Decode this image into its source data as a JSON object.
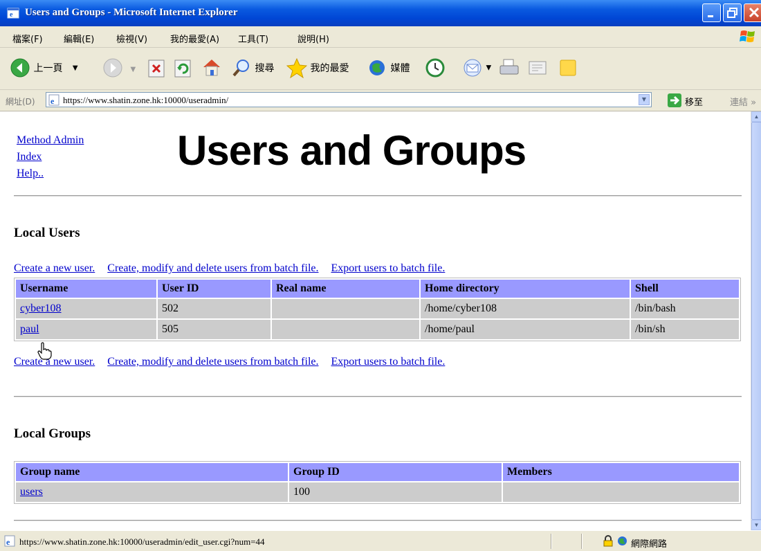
{
  "window": {
    "title": "Users and Groups - Microsoft Internet Explorer"
  },
  "menu": [
    "檔案(F)",
    "編輯(E)",
    "檢視(V)",
    "我的最愛(A)",
    "工具(T)",
    "說明(H)"
  ],
  "toolbar": {
    "back_label": "上一頁",
    "search_label": "搜尋",
    "favorites_label": "我的最愛",
    "media_label": "媒體"
  },
  "address": {
    "label": "網址(D)",
    "url": "https://www.shatin.zone.hk:10000/useradmin/",
    "go_label": "移至",
    "links_label": "連結"
  },
  "nav": {
    "method_admin": "Method Admin",
    "index": "Index",
    "help": "Help.."
  },
  "page_title": "Users and Groups",
  "users_section": {
    "heading": "Local Users",
    "links": {
      "create": "Create a new user.",
      "batch": "Create, modify and delete users from batch file.",
      "export": "Export users to batch file."
    },
    "columns": [
      "Username",
      "User ID",
      "Real name",
      "Home directory",
      "Shell"
    ],
    "rows": [
      {
        "username": "cyber108",
        "uid": "502",
        "realname": "",
        "home": "/home/cyber108",
        "shell": "/bin/bash"
      },
      {
        "username": "paul",
        "uid": "505",
        "realname": "",
        "home": "/home/paul",
        "shell": "/bin/sh"
      }
    ]
  },
  "groups_section": {
    "heading": "Local Groups",
    "columns": [
      "Group name",
      "Group ID",
      "Members"
    ],
    "rows": [
      {
        "name": "users",
        "gid": "100",
        "members": ""
      }
    ]
  },
  "status": {
    "text": "https://www.shatin.zone.hk:10000/useradmin/edit_user.cgi?num=44",
    "zone": "網際網路"
  },
  "colors": {
    "header_bg": "#9999ff",
    "cell_bg": "#cccccc",
    "link": "#0000cc"
  },
  "icons": [
    "ie-icon",
    "windows-logo-icon",
    "back-arrow-icon",
    "forward-arrow-icon",
    "stop-icon",
    "refresh-icon",
    "home-icon",
    "search-icon",
    "favorites-star-icon",
    "media-icon",
    "history-icon",
    "mail-icon",
    "print-icon",
    "edit-icon",
    "note-icon",
    "go-arrow-icon",
    "lock-icon",
    "globe-icon",
    "hand-cursor-icon"
  ]
}
